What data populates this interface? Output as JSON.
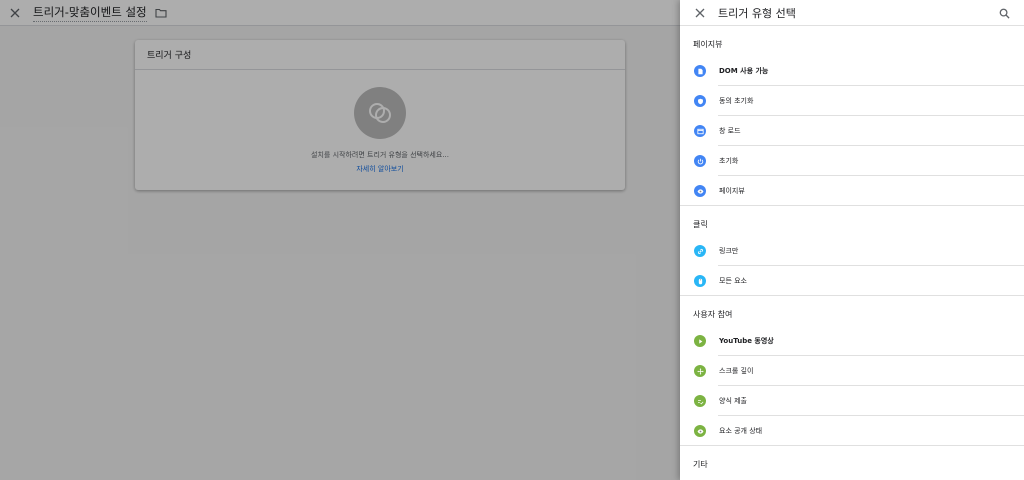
{
  "header": {
    "title": "트리거-맞춤이벤트 설정"
  },
  "card": {
    "title": "트리거 구성",
    "hint": "설치를 시작하려면 트리거 유형을 선택하세요...",
    "link": "자세히 알아보기"
  },
  "panel": {
    "title": "트리거 유형 선택",
    "groups": [
      {
        "label": "페이지뷰",
        "items": [
          {
            "label": "DOM 사용 가능",
            "icon": "document-icon",
            "color": "#4285f4"
          },
          {
            "label": "동의 초기화",
            "icon": "shield-icon",
            "color": "#4285f4"
          },
          {
            "label": "창 로드",
            "icon": "window-icon",
            "color": "#4285f4"
          },
          {
            "label": "초기화",
            "icon": "power-icon",
            "color": "#4285f4"
          },
          {
            "label": "페이지뷰",
            "icon": "eye-icon",
            "color": "#4285f4"
          }
        ]
      },
      {
        "label": "클릭",
        "items": [
          {
            "label": "링크만",
            "icon": "link-icon",
            "color": "#29b6f6"
          },
          {
            "label": "모든 요소",
            "icon": "mouse-icon",
            "color": "#29b6f6"
          }
        ]
      },
      {
        "label": "사용자 참여",
        "items": [
          {
            "label": "YouTube 동영상",
            "icon": "play-icon",
            "color": "#7cb342"
          },
          {
            "label": "스크롤 깊이",
            "icon": "move-icon",
            "color": "#7cb342"
          },
          {
            "label": "양식 제출",
            "icon": "form-icon",
            "color": "#7cb342"
          },
          {
            "label": "요소 공개 상태",
            "icon": "eye-icon",
            "color": "#7cb342"
          }
        ]
      },
      {
        "label": "기타",
        "items": []
      }
    ]
  }
}
